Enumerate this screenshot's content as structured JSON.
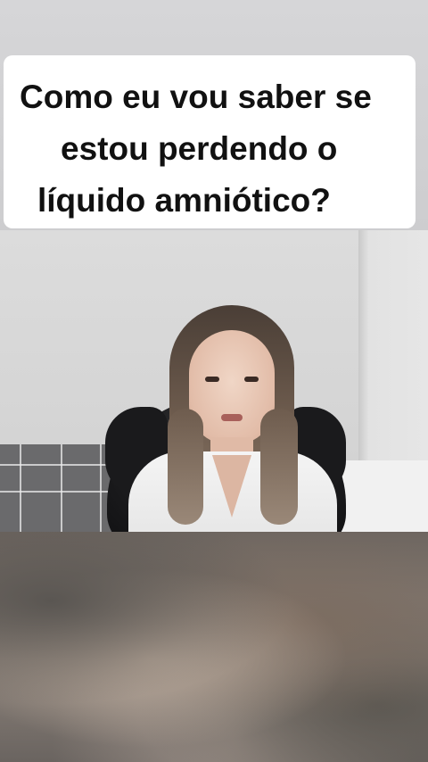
{
  "caption": {
    "lines": [
      "Como eu vou saber se",
      "estou perdendo o",
      "líquido amniótico?"
    ]
  },
  "colors": {
    "caption_background": "#ffffff",
    "caption_text": "#111111",
    "chair": "#1c1c1e",
    "coat": "#f4f4f4"
  }
}
